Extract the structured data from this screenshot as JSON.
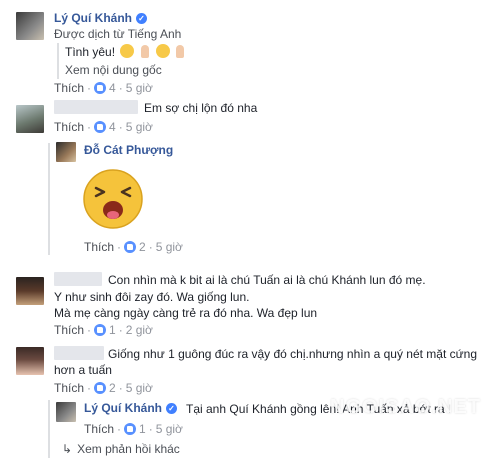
{
  "comment1": {
    "author": "Lý Quí Khánh",
    "translated_note": "Được dịch từ Tiếng Anh",
    "text": "Tình yêu!",
    "see_original": "Xem nội dung gốc",
    "like": "Thích",
    "like_count": "4",
    "time": "5 giờ"
  },
  "comment2": {
    "text": "Em sợ chị lộn đó nha",
    "like": "Thích",
    "like_count": "4",
    "time": "5 giờ"
  },
  "reply1": {
    "author": "Đỗ Cát Phượng",
    "sticker": "laughing-face-sticker",
    "like": "Thích",
    "like_count": "2",
    "time": "5 giờ"
  },
  "comment3": {
    "line1": "Con nhìn mà k bit ai là chú Tuấn ai là chú Khánh lun đó mẹ.",
    "line2": "Y như sinh đôi zay đó. Wa giống lun.",
    "line3": "Mà mẹ càng ngày càng trẻ ra đó nha. Wa đẹp lun",
    "like": "Thích",
    "like_count": "1",
    "time": "2 giờ"
  },
  "comment4": {
    "line1": "Giống như 1 guông đúc ra vậy đó chị.nhưng nhìn a quý nét mặt cứng",
    "line2": "hơn a tuấn",
    "like": "Thích",
    "like_count": "2",
    "time": "5 giờ"
  },
  "reply2": {
    "author": "Lý Quí Khánh",
    "text": "Tại anh Quí Khánh gồng lên! Anh Tuấn xả bớt ra !",
    "like": "Thích",
    "like_count": "1",
    "time": "5 giờ"
  },
  "more_replies": "Xem phản hồi khác",
  "watermark": "NGOISAO.NET",
  "colors": {
    "name": "#365899",
    "like_badge": "#5890ff",
    "meta": "#90949c"
  }
}
